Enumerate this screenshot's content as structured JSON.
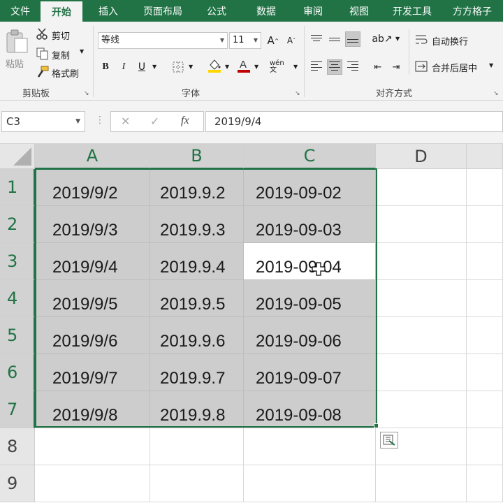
{
  "menu": {
    "tabs": [
      {
        "label": "文件",
        "active": false
      },
      {
        "label": "开始",
        "active": true
      },
      {
        "label": "插入",
        "active": false
      },
      {
        "label": "页面布局",
        "active": false
      },
      {
        "label": "公式",
        "active": false
      },
      {
        "label": "数据",
        "active": false
      },
      {
        "label": "审阅",
        "active": false
      },
      {
        "label": "视图",
        "active": false
      },
      {
        "label": "开发工具",
        "active": false
      },
      {
        "label": "方方格子",
        "active": false
      }
    ]
  },
  "ribbon": {
    "clipboard": {
      "paste_label": "粘贴",
      "cut_label": "剪切",
      "copy_label": "复制",
      "format_painter_label": "格式刷",
      "group_label": "剪贴板"
    },
    "font": {
      "font_name": "等线",
      "font_size": "11",
      "group_label": "字体",
      "bold": "B",
      "italic": "I",
      "underline": "U",
      "grow": "A",
      "shrink": "A",
      "font_color_letter": "A",
      "phonetic": "wén文"
    },
    "alignment": {
      "wrap_text_label": "自动换行",
      "merge_center_label": "合并后居中",
      "group_label": "对齐方式"
    }
  },
  "formula_bar": {
    "name_box": "C3",
    "fx": "fx",
    "formula": "2019/9/4"
  },
  "sheet": {
    "columns": [
      "A",
      "B",
      "C",
      "D"
    ],
    "rows": [
      "1",
      "2",
      "3",
      "4",
      "5",
      "6",
      "7",
      "8",
      "9"
    ],
    "cells": {
      "A": [
        "2019/9/2",
        "2019/9/3",
        "2019/9/4",
        "2019/9/5",
        "2019/9/6",
        "2019/9/7",
        "2019/9/8"
      ],
      "B": [
        "2019.9.2",
        "2019.9.3",
        "2019.9.4",
        "2019.9.5",
        "2019.9.6",
        "2019.9.7",
        "2019.9.8"
      ],
      "C": [
        "2019-09-02",
        "2019-09-03",
        "2019-09-04",
        "2019-09-05",
        "2019-09-06",
        "2019-09-07",
        "2019-09-08"
      ]
    },
    "active_cell": "C3",
    "selection_range": "A1:C7"
  },
  "colors": {
    "accent": "#217346",
    "selection_fill": "#cdcdcd",
    "font_color_bar": "#c00000",
    "fill_color_bar": "#ffd700"
  }
}
